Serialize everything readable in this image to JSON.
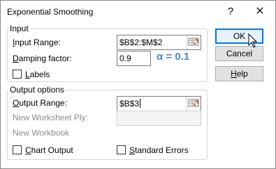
{
  "window": {
    "title": "Exponential Smoothing",
    "help_glyph": "?",
    "close_glyph": "✕"
  },
  "input_group": {
    "legend": "Input",
    "input_range": {
      "label_ul": "I",
      "label_rest": "nput Range:",
      "value": "$B$2:$M$2"
    },
    "damping": {
      "label_ul": "D",
      "label_rest": "amping factor:",
      "value": "0.9"
    },
    "labels_checkbox": {
      "label_ul": "L",
      "label_rest": "abels",
      "checked": false
    },
    "annotation": "α = 0.1"
  },
  "output_group": {
    "legend": "Output options",
    "output_range": {
      "label_ul": "O",
      "label_rest": "utput Range:",
      "value": "$B$3"
    },
    "new_ply_label": "New Worksheet Ply:",
    "new_workbook_label": "New Workbook",
    "chart_output": {
      "label_ul": "C",
      "label_rest": "hart Output",
      "checked": false
    },
    "standard_errors": {
      "label_ul": "S",
      "label_rest": "tandard Errors",
      "checked": false
    }
  },
  "buttons": {
    "ok": "OK",
    "cancel": "Cancel",
    "help_ul": "H",
    "help_rest": "elp"
  },
  "colors": {
    "accent": "#0078d7",
    "annotation": "#4a89c6"
  },
  "icons": [
    "refedit-icon",
    "cursor-arrow-icon"
  ]
}
